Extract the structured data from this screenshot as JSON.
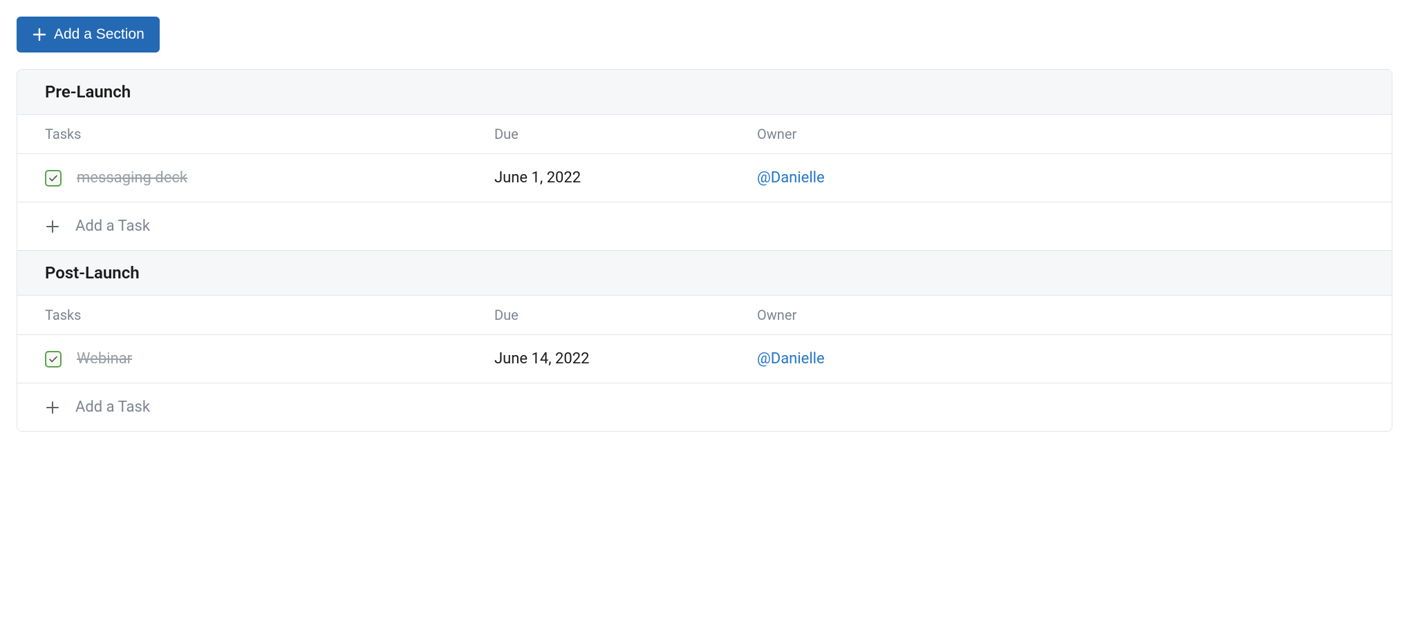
{
  "add_section_label": "Add a Section",
  "columns": {
    "tasks": "Tasks",
    "due": "Due",
    "owner": "Owner"
  },
  "add_task_label": "Add a Task",
  "sections": [
    {
      "title": "Pre-Launch",
      "tasks": [
        {
          "name": "messaging deck",
          "completed": true,
          "due": "June 1, 2022",
          "owner": "@Danielle"
        }
      ]
    },
    {
      "title": "Post-Launch",
      "tasks": [
        {
          "name": "Webinar",
          "completed": true,
          "due": "June 14, 2022",
          "owner": "@Danielle"
        }
      ]
    }
  ]
}
